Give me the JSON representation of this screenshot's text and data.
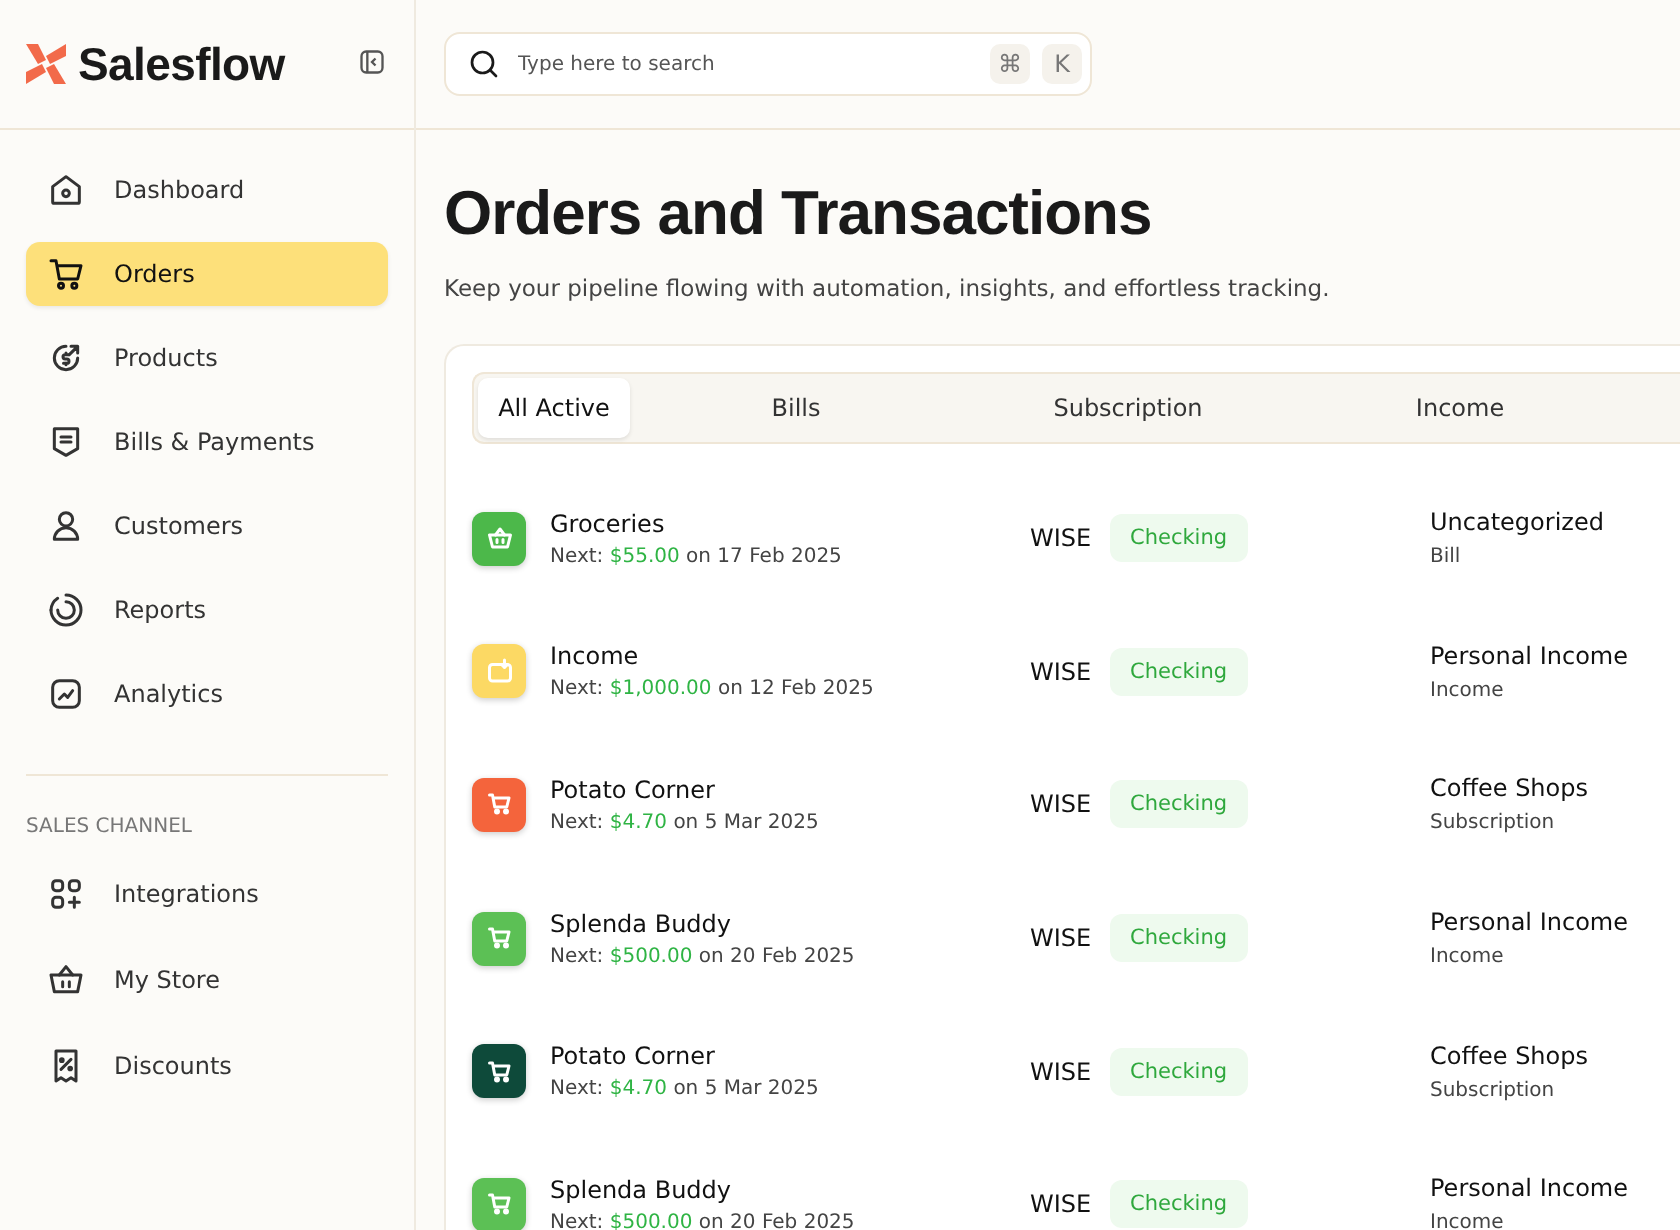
{
  "brand": {
    "name": "Salesflow"
  },
  "nav": [
    {
      "label": "Dashboard",
      "kind": "home",
      "selected": false
    },
    {
      "label": "Orders",
      "kind": "cart",
      "selected": true
    },
    {
      "label": "Products",
      "kind": "coin",
      "selected": false
    },
    {
      "label": "Bills & Payments",
      "kind": "bill",
      "selected": false
    },
    {
      "label": "Customers",
      "kind": "user",
      "selected": false
    },
    {
      "label": "Reports",
      "kind": "report",
      "selected": false
    },
    {
      "label": "Analytics",
      "kind": "chart",
      "selected": false
    }
  ],
  "sales_channel": {
    "heading": "SALES CHANNEL",
    "items": [
      {
        "label": "Integrations",
        "kind": "apps",
        "selected": false
      },
      {
        "label": "My Store",
        "kind": "basket",
        "selected": false
      },
      {
        "label": "Discounts",
        "kind": "discount",
        "selected": false
      }
    ]
  },
  "search": {
    "placeholder": "Type here to search",
    "keys": [
      "⌘",
      "K"
    ]
  },
  "page": {
    "title": "Orders and Transactions",
    "subtitle": "Keep your pipeline flowing with automation, insights, and effortless tracking."
  },
  "tabs": [
    {
      "label": "All Active",
      "selected": true
    },
    {
      "label": "Bills",
      "selected": false
    },
    {
      "label": "Subscription",
      "selected": false
    },
    {
      "label": "Income",
      "selected": false
    }
  ],
  "rows": [
    {
      "name": "Groceries",
      "kind": "basket",
      "color": "#4cb84a",
      "next_label": "Next:",
      "amount": "$55.00",
      "date": "on 17 Feb 2025",
      "bank": "WISE",
      "account": "Checking",
      "category": "Uncategorized",
      "type": "Bill"
    },
    {
      "name": "Income",
      "kind": "wallet",
      "color": "#fcd964",
      "next_label": "Next:",
      "amount": "$1,000.00",
      "date": "on 12 Feb 2025",
      "bank": "WISE",
      "account": "Checking",
      "category": "Personal Income",
      "type": "Income"
    },
    {
      "name": "Potato Corner",
      "kind": "cart",
      "color": "#f4643c",
      "next_label": "Next:",
      "amount": "$4.70",
      "date": "on 5 Mar 2025",
      "bank": "WISE",
      "account": "Checking",
      "category": "Coffee Shops",
      "type": "Subscription"
    },
    {
      "name": "Splenda Buddy",
      "kind": "cart",
      "color": "#5cc055",
      "next_label": "Next:",
      "amount": "$500.00",
      "date": "on 20 Feb 2025",
      "bank": "WISE",
      "account": "Checking",
      "category": "Personal Income",
      "type": "Income"
    },
    {
      "name": "Potato Corner",
      "kind": "cart",
      "color": "#0e4a3a",
      "next_label": "Next:",
      "amount": "$4.70",
      "date": "on 5 Mar 2025",
      "bank": "WISE",
      "account": "Checking",
      "category": "Coffee Shops",
      "type": "Subscription"
    },
    {
      "name": "Splenda Buddy",
      "kind": "cart",
      "color": "#5cc055",
      "next_label": "Next:",
      "amount": "$500.00",
      "date": "on 20 Feb 2025",
      "bank": "WISE",
      "account": "Checking",
      "category": "Personal Income",
      "type": "Income"
    }
  ]
}
